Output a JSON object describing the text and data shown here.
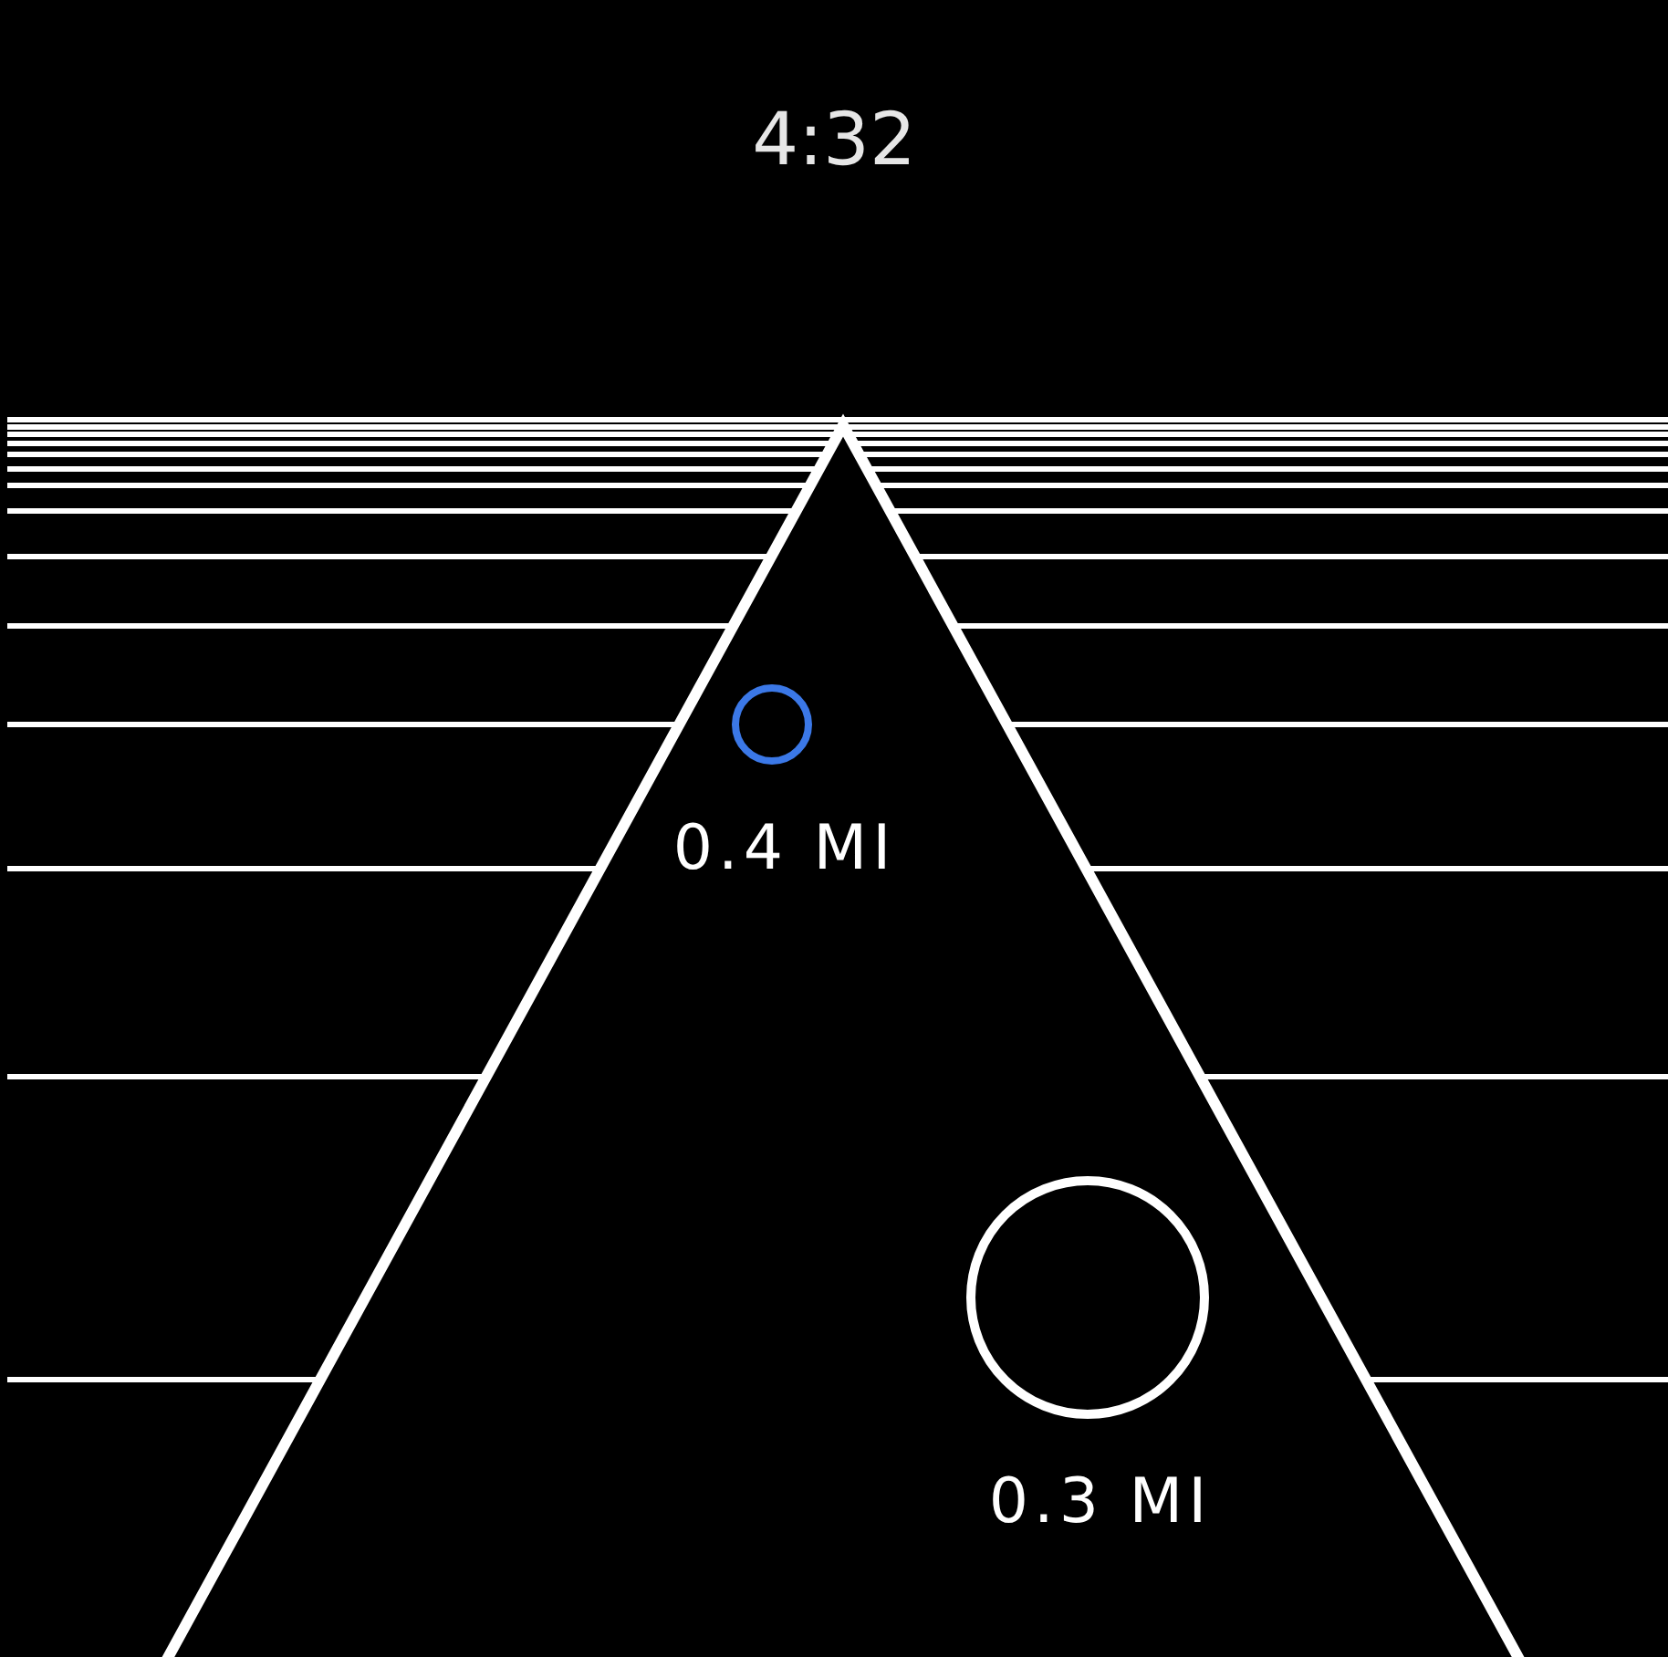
{
  "time": "4:32",
  "waypoints": [
    {
      "distance": "0.4 MI",
      "color": "#3b78e7"
    },
    {
      "distance": "0.3 MI",
      "color": "#ffffff"
    }
  ]
}
